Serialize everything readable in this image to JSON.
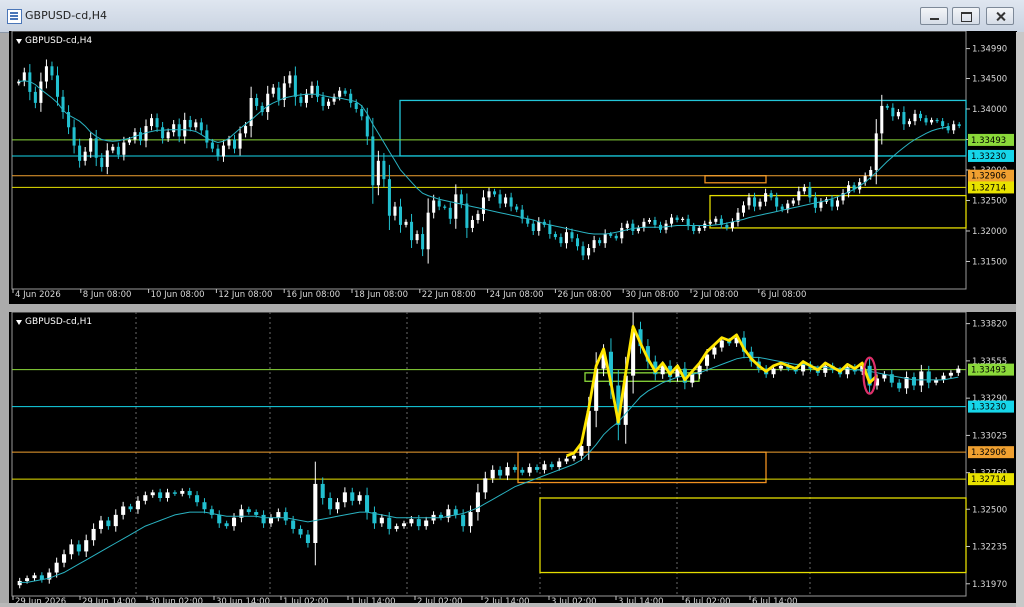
{
  "window": {
    "title": "GBPUSD-cd,H4"
  },
  "colors": {
    "bull": "#ffffff",
    "bear": "#22c0d0",
    "ma": "#2ab3c2",
    "grid": "#6a6a6a",
    "green_line": "#8bd93a",
    "cyan_line": "#16d6ea",
    "orange_line": "#f0a030",
    "yellow_line": "#e8e200",
    "rect_cyan": "#23c6d8",
    "rect_yellow": "#e4dc00",
    "rect_orange": "#f09020",
    "rect_green": "#8bd93a",
    "drawing_yellow": "#ffe600",
    "drawing_red": "#e0306a",
    "axis_text": "#d8d8d8"
  },
  "chart_data": [
    {
      "type": "candlestick",
      "symbol_label": "GBPUSD-cd,H4",
      "timeframe": "H4",
      "y_ticks": [
        "1.34990",
        "1.34500",
        "1.34000",
        "1.33500",
        "1.33000",
        "1.32500",
        "1.32000",
        "1.31500"
      ],
      "y_tick_values": [
        1.3499,
        1.345,
        1.34,
        1.335,
        1.33,
        1.325,
        1.32,
        1.315
      ],
      "ylim": [
        1.3118,
        1.3518
      ],
      "x_ticks": [
        "4 Jun 2026",
        "8 Jun 08:00",
        "10 Jun 08:00",
        "12 Jun 08:00",
        "16 Jun 08:00",
        "18 Jun 08:00",
        "22 Jun 08:00",
        "24 Jun 08:00",
        "26 Jun 08:00",
        "30 Jun 08:00",
        "2 Jul 08:00",
        "6 Jul 08:00"
      ],
      "price_levels": [
        {
          "name": "green-line",
          "price": 1.33493,
          "label": "1.33493",
          "color_key": "green_line"
        },
        {
          "name": "cyan-line",
          "price": 1.3323,
          "label": "1.33230",
          "color_key": "cyan_line"
        },
        {
          "name": "orange-line",
          "price": 1.32906,
          "label": "1.32906",
          "color_key": "orange_line"
        },
        {
          "name": "yellow-line",
          "price": 1.32714,
          "label": "1.32714",
          "color_key": "yellow_line"
        }
      ],
      "zones": [
        {
          "name": "cyan-zone",
          "p1": 1.3414,
          "p2": 1.3323,
          "color_key": "rect_cyan"
        },
        {
          "name": "orange-zone",
          "p1": 1.32906,
          "p2": 1.3279,
          "color_key": "rect_orange"
        },
        {
          "name": "yellow-zone",
          "p1": 1.3258,
          "p2": 1.3205,
          "color_key": "rect_yellow"
        }
      ],
      "close_series": [
        1.3445,
        1.346,
        1.3428,
        1.341,
        1.3445,
        1.347,
        1.3455,
        1.342,
        1.3395,
        1.337,
        1.334,
        1.3315,
        1.333,
        1.3352,
        1.332,
        1.3305,
        1.3332,
        1.3338,
        1.3325,
        1.3345,
        1.335,
        1.3362,
        1.3348,
        1.3372,
        1.3385,
        1.337,
        1.3352,
        1.3362,
        1.3375,
        1.3355,
        1.3382,
        1.337,
        1.3378,
        1.3365,
        1.3345,
        1.3335,
        1.3322,
        1.334,
        1.335,
        1.3335,
        1.336,
        1.3372,
        1.3418,
        1.3405,
        1.3395,
        1.3425,
        1.3435,
        1.3415,
        1.3442,
        1.3455,
        1.342,
        1.341,
        1.3425,
        1.3438,
        1.342,
        1.3405,
        1.3412,
        1.342,
        1.343,
        1.3425,
        1.341,
        1.34,
        1.3388,
        1.3355,
        1.3275,
        1.3315,
        1.3285,
        1.3225,
        1.324,
        1.321,
        1.3215,
        1.3185,
        1.3195,
        1.317,
        1.323,
        1.325,
        1.324,
        1.3238,
        1.322,
        1.326,
        1.3245,
        1.3205,
        1.3218,
        1.3228,
        1.3255,
        1.3265,
        1.326,
        1.3245,
        1.3255,
        1.324,
        1.3235,
        1.322,
        1.3212,
        1.32,
        1.3215,
        1.321,
        1.3195,
        1.319,
        1.318,
        1.3198,
        1.3188,
        1.3175,
        1.316,
        1.3172,
        1.3185,
        1.318,
        1.3195,
        1.3192,
        1.3188,
        1.3205,
        1.3212,
        1.32,
        1.3205,
        1.3215,
        1.3218,
        1.321,
        1.3202,
        1.3212,
        1.3222,
        1.3218,
        1.322,
        1.3208,
        1.32,
        1.3205,
        1.3212,
        1.3215,
        1.322,
        1.321,
        1.3205,
        1.3215,
        1.323,
        1.3242,
        1.3255,
        1.324,
        1.3248,
        1.3262,
        1.3255,
        1.324,
        1.3235,
        1.3245,
        1.325,
        1.3265,
        1.3272,
        1.3255,
        1.3238,
        1.3248,
        1.3252,
        1.324,
        1.325,
        1.3262,
        1.3275,
        1.3268,
        1.328,
        1.329,
        1.33,
        1.336,
        1.3405,
        1.3402,
        1.3388,
        1.3395,
        1.3375,
        1.338,
        1.3392,
        1.3385,
        1.3378,
        1.3382,
        1.338,
        1.3372,
        1.3365,
        1.3375,
        1.3372
      ],
      "ma_series": [
        1.3445,
        1.3446,
        1.3445,
        1.344,
        1.3432,
        1.3425,
        1.3418,
        1.341,
        1.3398,
        1.339,
        1.3385,
        1.338,
        1.3372,
        1.3362,
        1.3355,
        1.335,
        1.3348,
        1.3347,
        1.3348,
        1.335,
        1.3352,
        1.3355,
        1.3358,
        1.3361,
        1.3363,
        1.3365,
        1.3365,
        1.3366,
        1.3366,
        1.3366,
        1.3366,
        1.3365,
        1.3363,
        1.3358,
        1.3352,
        1.3348,
        1.3345,
        1.3347,
        1.3352,
        1.336,
        1.3368,
        1.3375,
        1.3382,
        1.339,
        1.3398,
        1.3405,
        1.341,
        1.3414,
        1.3418,
        1.342,
        1.3422,
        1.3423,
        1.3424,
        1.3424,
        1.3424,
        1.3422,
        1.342,
        1.3418,
        1.3418,
        1.3416,
        1.3414,
        1.3412,
        1.3405,
        1.3392,
        1.3375,
        1.336,
        1.3345,
        1.333,
        1.3315,
        1.33,
        1.329,
        1.328,
        1.327,
        1.3262,
        1.3258,
        1.3255,
        1.3252,
        1.325,
        1.3248,
        1.3246,
        1.3244,
        1.3242,
        1.324,
        1.3238,
        1.3236,
        1.3234,
        1.3232,
        1.323,
        1.3228,
        1.3226,
        1.3224,
        1.3222,
        1.322,
        1.3218,
        1.3215,
        1.3212,
        1.321,
        1.3208,
        1.3206,
        1.3204,
        1.3202,
        1.32,
        1.3198,
        1.3196,
        1.3195,
        1.3195,
        1.3195,
        1.3196,
        1.3198,
        1.32,
        1.3202,
        1.3204,
        1.3205,
        1.3206,
        1.3206,
        1.3206,
        1.3206,
        1.3207,
        1.3208,
        1.3209,
        1.3209,
        1.3209,
        1.3209,
        1.3209,
        1.3209,
        1.3209,
        1.321,
        1.3211,
        1.3213,
        1.3215,
        1.3217,
        1.3219,
        1.3222,
        1.3224,
        1.3226,
        1.3228,
        1.323,
        1.3232,
        1.3234,
        1.3236,
        1.3238,
        1.324,
        1.3242,
        1.3244,
        1.3246,
        1.3248,
        1.325,
        1.3253,
        1.3256,
        1.326,
        1.3264,
        1.3268,
        1.3274,
        1.328,
        1.3288,
        1.3296,
        1.3305,
        1.3314,
        1.3322,
        1.333,
        1.3337,
        1.3344,
        1.335,
        1.3355,
        1.336,
        1.3364,
        1.3367,
        1.3369,
        1.337
      ]
    },
    {
      "type": "candlestick",
      "symbol_label": "GBPUSD-cd,H1",
      "timeframe": "H1",
      "y_ticks": [
        "1.33820",
        "1.33555",
        "1.33290",
        "1.33025",
        "1.32760",
        "1.32500",
        "1.32235",
        "1.31970"
      ],
      "y_tick_values": [
        1.3382,
        1.33555,
        1.3329,
        1.33025,
        1.3276,
        1.325,
        1.32235,
        1.3197
      ],
      "ylim": [
        1.3194,
        1.3386
      ],
      "x_ticks": [
        "29 Jun 2026",
        "29 Jun 14:00",
        "30 Jun 02:00",
        "30 Jun 14:00",
        "1 Jul 02:00",
        "1 Jul 14:00",
        "2 Jul 02:00",
        "2 Jul 14:00",
        "3 Jul 02:00",
        "3 Jul 14:00",
        "6 Jul 02:00",
        "6 Jul 14:00"
      ],
      "price_levels": [
        {
          "name": "green-line",
          "price": 1.33493,
          "label": "1.33493",
          "color_key": "green_line"
        },
        {
          "name": "cyan-line",
          "price": 1.3323,
          "label": "1.33230",
          "color_key": "cyan_line"
        },
        {
          "name": "orange-line",
          "price": 1.32906,
          "label": "1.32906",
          "color_key": "orange_line"
        },
        {
          "name": "yellow-line",
          "price": 1.32714,
          "label": "1.32714",
          "color_key": "yellow_line"
        }
      ],
      "zones": [
        {
          "name": "orange-zone",
          "p1": 1.32906,
          "p2": 1.3269,
          "color_key": "rect_orange"
        },
        {
          "name": "yellow-zone",
          "p1": 1.3258,
          "p2": 1.3205,
          "color_key": "rect_yellow"
        },
        {
          "name": "green-zone",
          "p1": 1.3347,
          "p2": 1.3341,
          "color_key": "rect_green"
        }
      ],
      "close_series": [
        1.3199,
        1.3201,
        1.3203,
        1.32,
        1.3205,
        1.3212,
        1.3218,
        1.3225,
        1.322,
        1.3228,
        1.3236,
        1.3242,
        1.3238,
        1.3246,
        1.3252,
        1.325,
        1.3256,
        1.326,
        1.3262,
        1.3258,
        1.3262,
        1.3261,
        1.3263,
        1.326,
        1.3255,
        1.325,
        1.3246,
        1.324,
        1.3238,
        1.3244,
        1.325,
        1.3248,
        1.3246,
        1.324,
        1.3244,
        1.3248,
        1.3242,
        1.3236,
        1.3232,
        1.3226,
        1.3268,
        1.3258,
        1.325,
        1.3255,
        1.3262,
        1.3256,
        1.326,
        1.3248,
        1.324,
        1.3244,
        1.3236,
        1.3238,
        1.324,
        1.3243,
        1.3238,
        1.3242,
        1.3246,
        1.3244,
        1.325,
        1.3246,
        1.3238,
        1.3248,
        1.3262,
        1.3272,
        1.3278,
        1.3274,
        1.328,
        1.3278,
        1.3276,
        1.328,
        1.3278,
        1.3282,
        1.328,
        1.3284,
        1.3286,
        1.3288,
        1.3295,
        1.332,
        1.335,
        1.3362,
        1.3338,
        1.331,
        1.3345,
        1.3378,
        1.3366,
        1.3355,
        1.3346,
        1.3352,
        1.3344,
        1.335,
        1.334,
        1.3346,
        1.3352,
        1.336,
        1.3365,
        1.337,
        1.3368,
        1.3372,
        1.3362,
        1.3355,
        1.335,
        1.3346,
        1.335,
        1.3352,
        1.335,
        1.3348,
        1.3353,
        1.335,
        1.3347,
        1.3352,
        1.3349,
        1.3346,
        1.3351,
        1.3348,
        1.3352,
        1.3338,
        1.3343,
        1.3346,
        1.334,
        1.3336,
        1.3344,
        1.3338,
        1.3348,
        1.334,
        1.3342,
        1.3345,
        1.3347,
        1.335
      ],
      "ma_series": [
        1.3198,
        1.3198,
        1.3199,
        1.32,
        1.3201,
        1.3203,
        1.3205,
        1.3208,
        1.3211,
        1.3214,
        1.3217,
        1.322,
        1.3223,
        1.3226,
        1.3229,
        1.3232,
        1.3235,
        1.3238,
        1.324,
        1.3242,
        1.3244,
        1.3246,
        1.3247,
        1.3248,
        1.3248,
        1.3248,
        1.3247,
        1.3246,
        1.3245,
        1.3245,
        1.3245,
        1.3245,
        1.3245,
        1.3244,
        1.3244,
        1.3244,
        1.3244,
        1.3243,
        1.3242,
        1.3241,
        1.3242,
        1.3243,
        1.3244,
        1.3245,
        1.3246,
        1.3247,
        1.3248,
        1.3248,
        1.3247,
        1.3246,
        1.3245,
        1.3244,
        1.3244,
        1.3244,
        1.3244,
        1.3244,
        1.3244,
        1.3244,
        1.3245,
        1.3246,
        1.3247,
        1.3249,
        1.3251,
        1.3254,
        1.3257,
        1.326,
        1.3263,
        1.3266,
        1.3268,
        1.327,
        1.3272,
        1.3274,
        1.3276,
        1.3278,
        1.328,
        1.3282,
        1.3285,
        1.329,
        1.3296,
        1.3303,
        1.3308,
        1.3312,
        1.3318,
        1.3324,
        1.333,
        1.3334,
        1.3337,
        1.334,
        1.3342,
        1.3344,
        1.3345,
        1.3346,
        1.3347,
        1.3349,
        1.3351,
        1.3353,
        1.3355,
        1.3357,
        1.3358,
        1.3358,
        1.3358,
        1.3357,
        1.3356,
        1.3355,
        1.3354,
        1.3353,
        1.3353,
        1.3352,
        1.3351,
        1.3351,
        1.335,
        1.335,
        1.335,
        1.3349,
        1.3349,
        1.3348,
        1.3347,
        1.3346,
        1.3345,
        1.3344,
        1.3343,
        1.3342,
        1.3342,
        1.3342,
        1.3342,
        1.3342,
        1.3343,
        1.3344
      ]
    }
  ]
}
